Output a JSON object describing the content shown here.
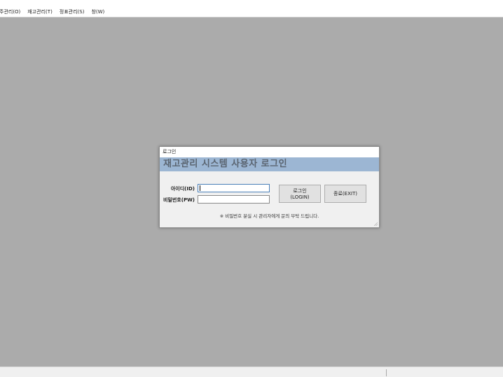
{
  "menubar": {
    "items": [
      {
        "label": "주관리(O)"
      },
      {
        "label": "재고관리(T)"
      },
      {
        "label": "정표관리(S)"
      },
      {
        "label": "창(W)"
      }
    ]
  },
  "dialog": {
    "title": "로그인",
    "banner": "재고관리 시스템 사용자 로그인",
    "id_label": "아이디(ID)",
    "id_value": "",
    "pw_label": "비밀번호(PW)",
    "pw_value": "",
    "login_button": "로그인(LOGIN)",
    "exit_button": "종료(EXIT)",
    "notice": "※ 비밀번호 분실 시 관리자에게 문의 부탁 드립니다."
  },
  "colors": {
    "mdi_background": "#ababab",
    "banner_background": "#9cb6d3",
    "banner_text": "#5a6470"
  }
}
